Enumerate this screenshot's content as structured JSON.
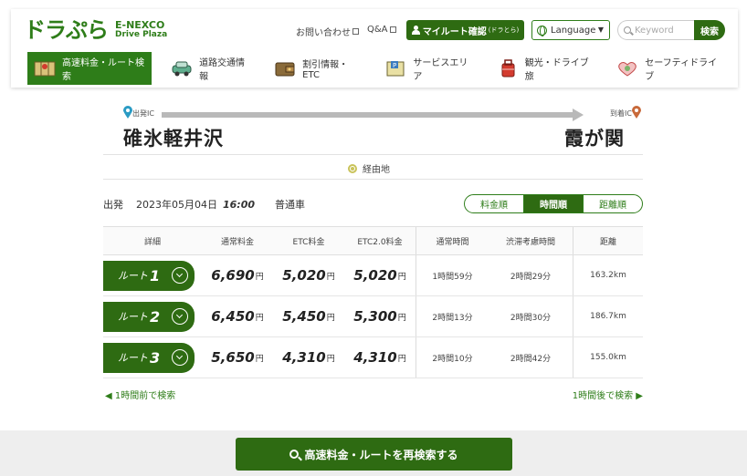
{
  "header": {
    "logo_jp": "ドラぷら",
    "logo_en_1": "E-NEXCO",
    "logo_en_2": "Drive Plaza",
    "contact": "お問い合わせ",
    "qa": "Q&A",
    "myroute": "マイルート確認",
    "myroute_sub": "(ドラとら)",
    "language": "Language",
    "search_placeholder": "Keyword",
    "search_button": "検索"
  },
  "nav": [
    {
      "label": "高速料金・ルート検索",
      "icon": "map-icon",
      "active": true
    },
    {
      "label": "道路交通情報",
      "icon": "car-icon",
      "active": false
    },
    {
      "label": "割引情報・ETC",
      "icon": "wallet-icon",
      "active": false
    },
    {
      "label": "サービスエリア",
      "icon": "parking-icon",
      "active": false
    },
    {
      "label": "観光・ドライブ旅",
      "icon": "suitcase-icon",
      "active": false
    },
    {
      "label": "セーフティドライブ",
      "icon": "safety-icon",
      "active": false
    }
  ],
  "route": {
    "departure_label": "出発IC",
    "arrival_label": "到着IC",
    "origin": "碓氷軽井沢",
    "destination": "霞が関",
    "via": "経由地"
  },
  "conditions": {
    "label": "出発",
    "date": "2023年05月04日",
    "time": "16:00",
    "vehicle": "普通車"
  },
  "sort": [
    "料金順",
    "時間順",
    "距離順"
  ],
  "sort_active": 1,
  "table": {
    "headers": [
      "詳細",
      "通常料金",
      "ETC料金",
      "ETC2.0料金",
      "通常時間",
      "渋滞考慮時間",
      "距離"
    ],
    "route_prefix": "ルート",
    "yen": "円",
    "rows": [
      {
        "num": "1",
        "normal": "6,690",
        "etc": "5,020",
        "etc2": "5,020",
        "time": "1時間59分",
        "jam_time": "2時間29分",
        "distance": "163.2km"
      },
      {
        "num": "2",
        "normal": "6,450",
        "etc": "5,450",
        "etc2": "5,300",
        "time": "2時間13分",
        "jam_time": "2時間30分",
        "distance": "186.7km"
      },
      {
        "num": "3",
        "normal": "5,650",
        "etc": "4,310",
        "etc2": "4,310",
        "time": "2時間10分",
        "jam_time": "2時間42分",
        "distance": "155.0km"
      }
    ]
  },
  "links": {
    "prev": "◀ 1時間前で検索",
    "next": "1時間後で検索 ▶"
  },
  "research_button": "高速料金・ルートを再検索する",
  "colors": {
    "brand": "#2e7d19",
    "brand_dark": "#2e6b12"
  }
}
